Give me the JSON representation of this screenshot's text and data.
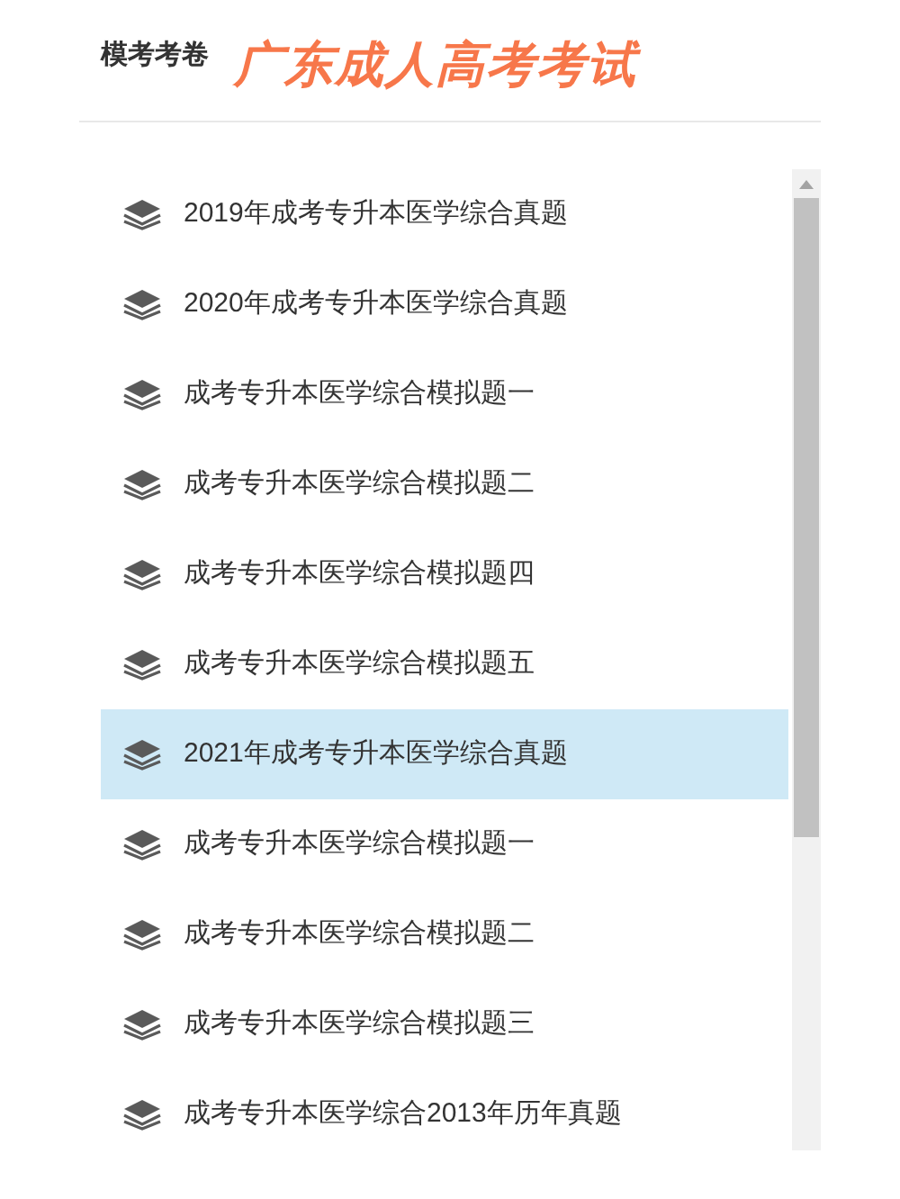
{
  "header": {
    "title": "模考考卷",
    "banner": "广东成人高考考试"
  },
  "items": [
    {
      "label": "2019年成考专升本医学综合真题",
      "selected": false
    },
    {
      "label": "2020年成考专升本医学综合真题",
      "selected": false
    },
    {
      "label": "成考专升本医学综合模拟题一",
      "selected": false
    },
    {
      "label": "成考专升本医学综合模拟题二",
      "selected": false
    },
    {
      "label": "成考专升本医学综合模拟题四",
      "selected": false
    },
    {
      "label": "成考专升本医学综合模拟题五",
      "selected": false
    },
    {
      "label": "2021年成考专升本医学综合真题",
      "selected": true
    },
    {
      "label": "成考专升本医学综合模拟题一",
      "selected": false
    },
    {
      "label": "成考专升本医学综合模拟题二",
      "selected": false
    },
    {
      "label": "成考专升本医学综合模拟题三",
      "selected": false
    },
    {
      "label": "成考专升本医学综合2013年历年真题",
      "selected": false
    }
  ]
}
